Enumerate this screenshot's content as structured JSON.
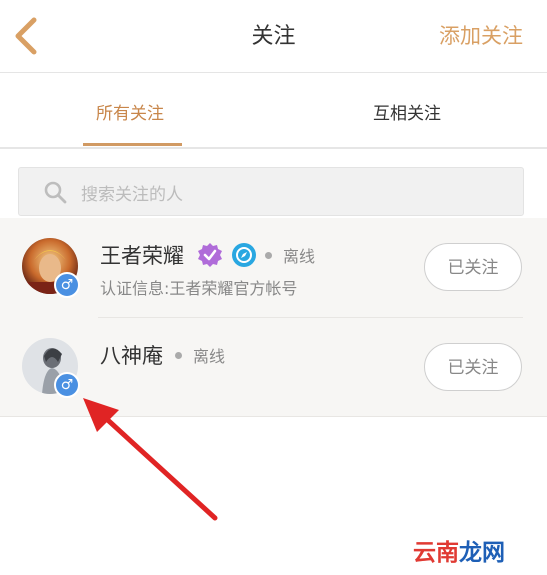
{
  "header": {
    "title": "关注",
    "action_label": "添加关注",
    "accent_color": "#d9a064"
  },
  "tabs": [
    {
      "label": "所有关注",
      "active": true
    },
    {
      "label": "互相关注",
      "active": false
    }
  ],
  "search": {
    "placeholder": "搜索关注的人"
  },
  "following": [
    {
      "name": "王者荣耀",
      "status": "离线",
      "cert": "认证信息:王者荣耀官方帐号",
      "gender_symbol": "♂",
      "button_label": "已关注",
      "verified": true
    },
    {
      "name": "八神庵",
      "status": "离线",
      "gender_symbol": "♂",
      "button_label": "已关注",
      "verified": false
    }
  ],
  "watermark": {
    "part1": "云南",
    "part2": "龙网"
  }
}
